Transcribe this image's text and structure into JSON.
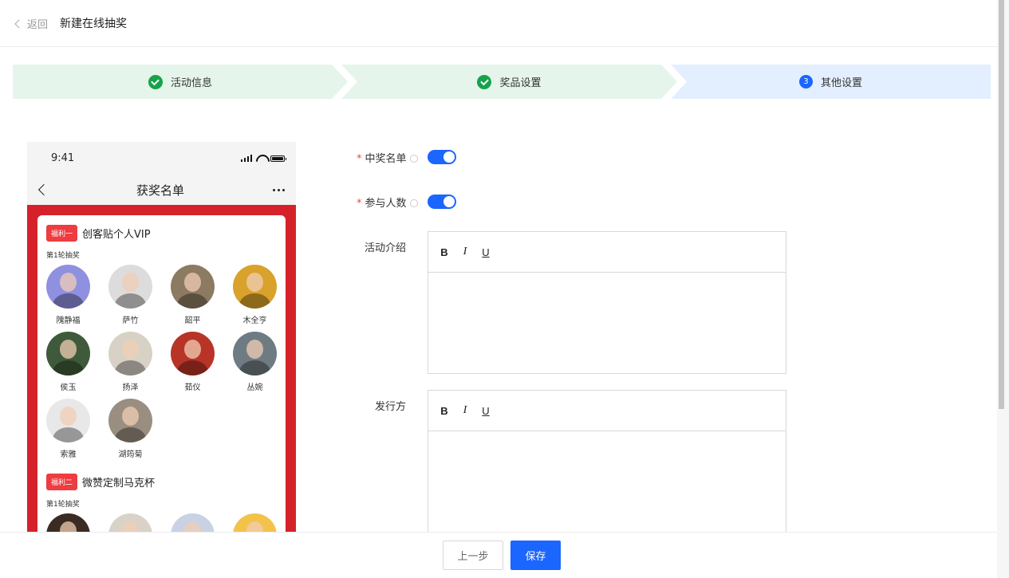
{
  "header": {
    "back_label": "返回",
    "title": "新建在线抽奖"
  },
  "steps": [
    {
      "label": "活动信息",
      "status": "done"
    },
    {
      "label": "奖品设置",
      "status": "done"
    },
    {
      "label": "其他设置",
      "status": "current",
      "number": "3"
    }
  ],
  "preview": {
    "time": "9:41",
    "nav_title": "获奖名单",
    "prizes": [
      {
        "tag": "福利一",
        "name": "创客贴个人VIP",
        "round": "第1轮抽奖",
        "winners": [
          {
            "name": "隗静福",
            "color": "#8f90e0"
          },
          {
            "name": "萨竹",
            "color": "#dcdcdc"
          },
          {
            "name": "韶平",
            "color": "#8c7a62"
          },
          {
            "name": "木全亨",
            "color": "#d9a22c"
          },
          {
            "name": "侯玉",
            "color": "#3f5a3a"
          },
          {
            "name": "扬泽",
            "color": "#d8d2c6"
          },
          {
            "name": "茹仪",
            "color": "#b83427"
          },
          {
            "name": "丛婉",
            "color": "#6f7b82"
          },
          {
            "name": "索雅",
            "color": "#e8e8e8"
          },
          {
            "name": "湖筠菊",
            "color": "#9a8e80"
          }
        ]
      },
      {
        "tag": "福利二",
        "name": "微赞定制马克杯",
        "round": "第1轮抽奖",
        "winners": [
          {
            "name": "",
            "color": "#3a2c22"
          },
          {
            "name": "",
            "color": "#d9d2c8"
          },
          {
            "name": "",
            "color": "#c8d2e4"
          },
          {
            "name": "",
            "color": "#f2c24a"
          }
        ]
      }
    ]
  },
  "form": {
    "winner_list_label": "中奖名单",
    "participants_label": "参与人数",
    "intro_label": "活动介绍",
    "publisher_label": "发行方",
    "toolbar": {
      "bold": "B",
      "italic": "I",
      "underline": "U"
    },
    "winner_list_on": true,
    "participants_on": true
  },
  "footer": {
    "prev_label": "上一步",
    "save_label": "保存"
  }
}
